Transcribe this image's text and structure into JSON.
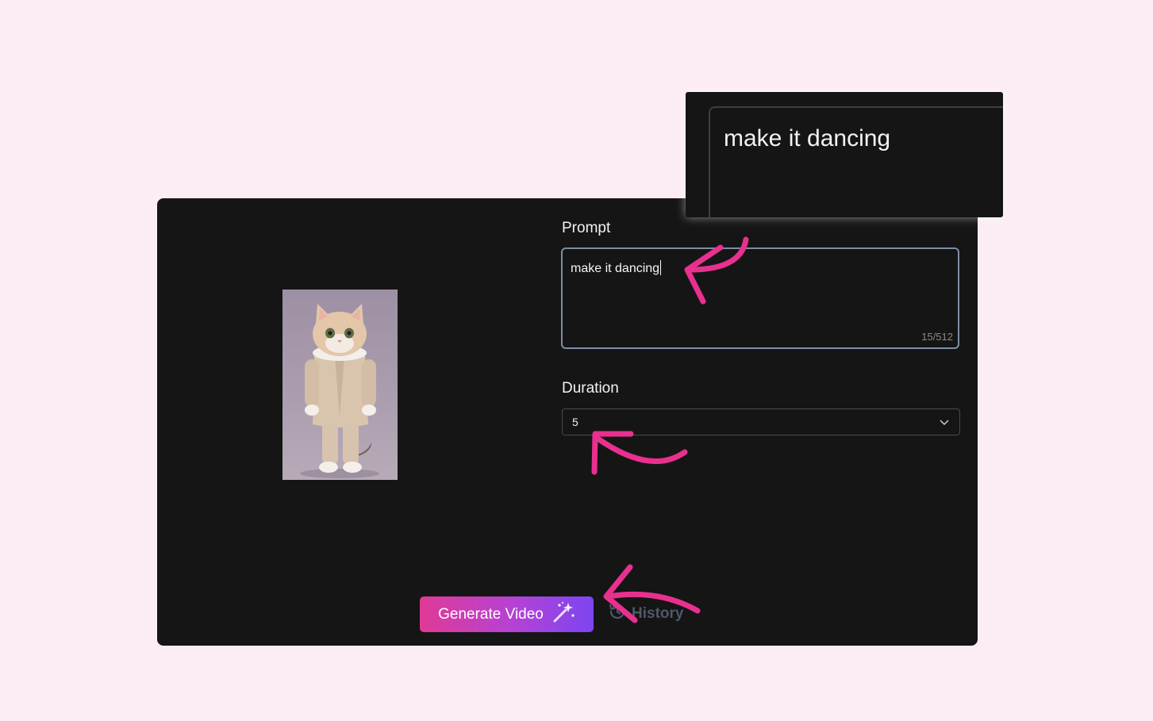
{
  "prompt": {
    "label": "Prompt",
    "value": "make it dancing",
    "counter": "15/512"
  },
  "duration": {
    "label": "Duration",
    "selected": "5"
  },
  "actions": {
    "generate_label": "Generate Video",
    "history_label": "History"
  },
  "zoom_callout": {
    "text": "make it dancing"
  },
  "colors": {
    "page_background": "#fcedf4",
    "panel_background": "#151515",
    "annotation_arrow": "#e8308f",
    "button_gradient_start": "#e03a95",
    "button_gradient_end": "#7c45f0"
  },
  "icons": {
    "generate": "magic-wand-icon",
    "history": "history-clock-icon",
    "select": "chevron-down-icon"
  }
}
